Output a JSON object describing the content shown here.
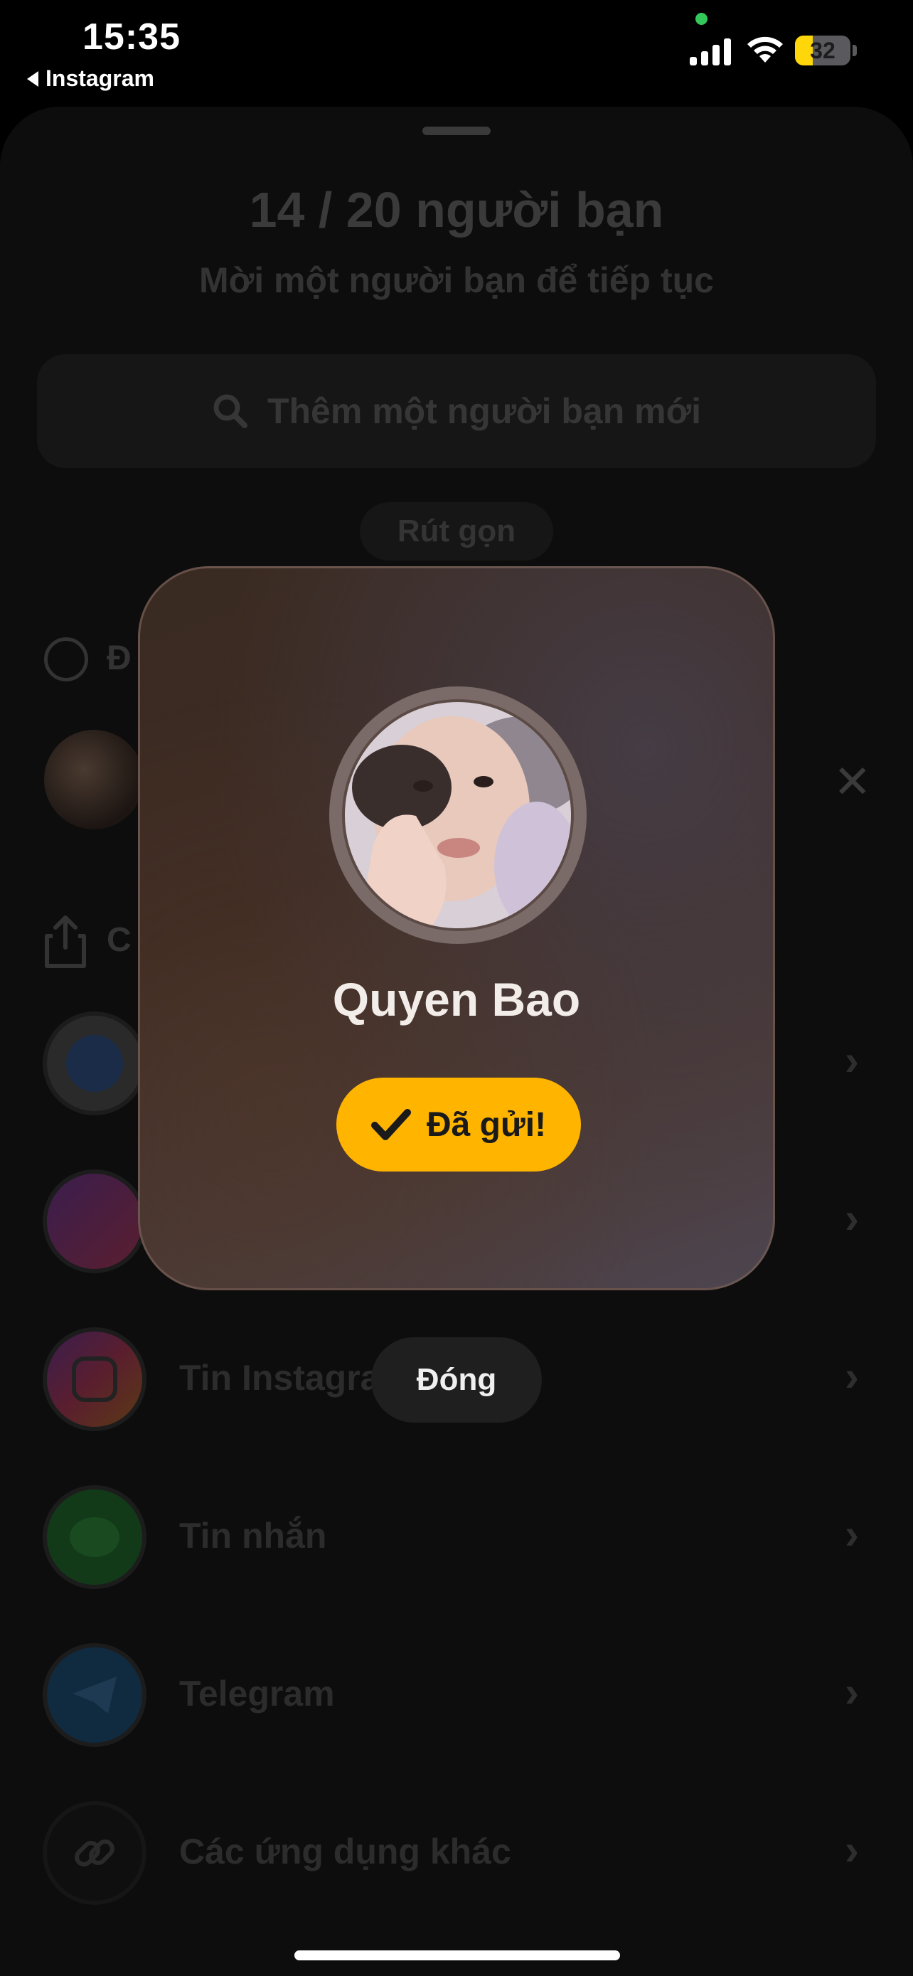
{
  "status_bar": {
    "time": "15:35",
    "back_app": "Instagram",
    "battery": "32",
    "battery_level_fraction": 0.32,
    "privacy_dot_color": "#34c759"
  },
  "sheet": {
    "title": "14 / 20 người bạn",
    "subtitle": "Mời một người bạn để tiếp tục",
    "search_placeholder": "Thêm một người bạn mới",
    "collapse_label": "Rút gọn",
    "friends_section_label": "Đ",
    "share_section_label": "C",
    "share_options": [
      {
        "label": "",
        "icon": "messenger-icon",
        "color": "#3a3a3a"
      },
      {
        "label": "",
        "icon": "messenger-icon",
        "color": "#4a2a5a"
      },
      {
        "label": "Tin Instagram",
        "icon": "instagram-icon",
        "color": "#5a2a3a"
      },
      {
        "label": "Tin nhắn",
        "icon": "message-icon",
        "color": "#163e1c"
      },
      {
        "label": "Telegram",
        "icon": "telegram-icon",
        "color": "#13324a"
      },
      {
        "label": "Các ứng dụng khác",
        "icon": "link-icon",
        "color": "#161616"
      }
    ]
  },
  "modal": {
    "name": "Quyen Bao",
    "sent_label": "Đã gửi!",
    "accent_color": "#ffb400"
  },
  "close_label": "Đóng"
}
